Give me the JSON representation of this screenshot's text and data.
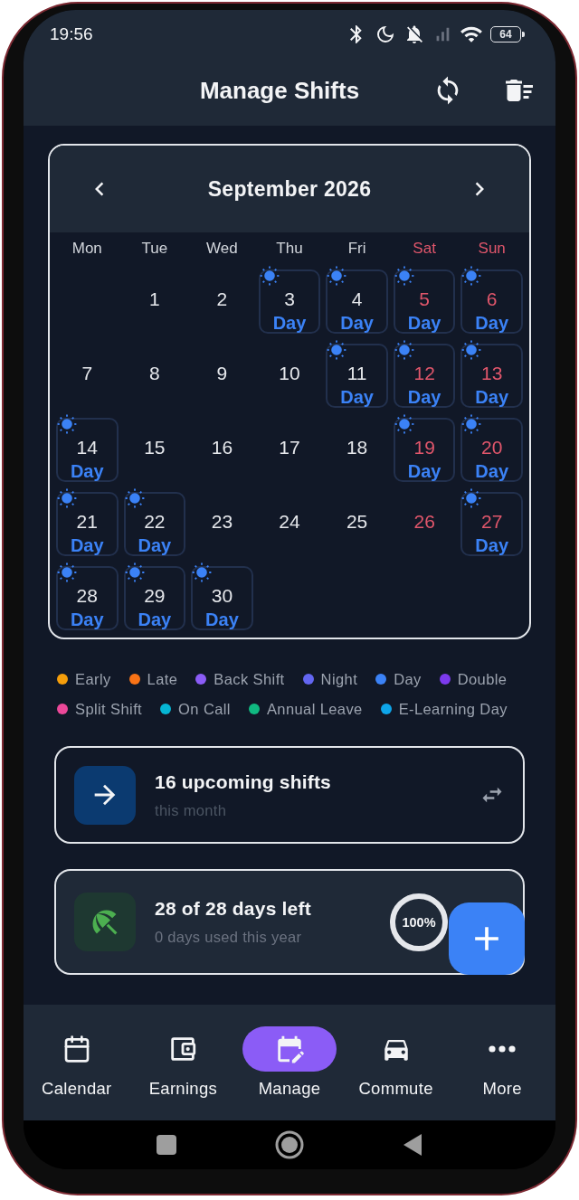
{
  "status_bar": {
    "time": "19:56",
    "battery": "64"
  },
  "header": {
    "title": "Manage Shifts"
  },
  "calendar": {
    "month": "September 2026",
    "weekdays": [
      {
        "label": "Mon",
        "weekend": false
      },
      {
        "label": "Tue",
        "weekend": false
      },
      {
        "label": "Wed",
        "weekend": false
      },
      {
        "label": "Thu",
        "weekend": false
      },
      {
        "label": "Fri",
        "weekend": false
      },
      {
        "label": "Sat",
        "weekend": true
      },
      {
        "label": "Sun",
        "weekend": true
      }
    ],
    "weeks": [
      [
        {
          "kind": "blank"
        },
        {
          "kind": "day",
          "number": "1",
          "weekend": false
        },
        {
          "kind": "day",
          "number": "2",
          "weekend": false
        },
        {
          "kind": "day",
          "number": "3",
          "weekend": false,
          "shift": {
            "label": "Day",
            "color": "#3b82f6"
          }
        },
        {
          "kind": "day",
          "number": "4",
          "weekend": false,
          "shift": {
            "label": "Day",
            "color": "#3b82f6"
          }
        },
        {
          "kind": "day",
          "number": "5",
          "weekend": true,
          "shift": {
            "label": "Day",
            "color": "#3b82f6"
          }
        },
        {
          "kind": "day",
          "number": "6",
          "weekend": true,
          "shift": {
            "label": "Day",
            "color": "#3b82f6"
          }
        }
      ],
      [
        {
          "kind": "day",
          "number": "7",
          "weekend": false
        },
        {
          "kind": "day",
          "number": "8",
          "weekend": false
        },
        {
          "kind": "day",
          "number": "9",
          "weekend": false
        },
        {
          "kind": "day",
          "number": "10",
          "weekend": false
        },
        {
          "kind": "day",
          "number": "11",
          "weekend": false,
          "shift": {
            "label": "Day",
            "color": "#3b82f6"
          }
        },
        {
          "kind": "day",
          "number": "12",
          "weekend": true,
          "shift": {
            "label": "Day",
            "color": "#3b82f6"
          }
        },
        {
          "kind": "day",
          "number": "13",
          "weekend": true,
          "shift": {
            "label": "Day",
            "color": "#3b82f6"
          }
        }
      ],
      [
        {
          "kind": "day",
          "number": "14",
          "weekend": false,
          "shift": {
            "label": "Day",
            "color": "#3b82f6"
          }
        },
        {
          "kind": "day",
          "number": "15",
          "weekend": false
        },
        {
          "kind": "day",
          "number": "16",
          "weekend": false
        },
        {
          "kind": "day",
          "number": "17",
          "weekend": false
        },
        {
          "kind": "day",
          "number": "18",
          "weekend": false
        },
        {
          "kind": "day",
          "number": "19",
          "weekend": true,
          "shift": {
            "label": "Day",
            "color": "#3b82f6"
          }
        },
        {
          "kind": "day",
          "number": "20",
          "weekend": true,
          "shift": {
            "label": "Day",
            "color": "#3b82f6"
          }
        }
      ],
      [
        {
          "kind": "day",
          "number": "21",
          "weekend": false,
          "shift": {
            "label": "Day",
            "color": "#3b82f6"
          }
        },
        {
          "kind": "day",
          "number": "22",
          "weekend": false,
          "shift": {
            "label": "Day",
            "color": "#3b82f6"
          }
        },
        {
          "kind": "day",
          "number": "23",
          "weekend": false
        },
        {
          "kind": "day",
          "number": "24",
          "weekend": false
        },
        {
          "kind": "day",
          "number": "25",
          "weekend": false
        },
        {
          "kind": "day",
          "number": "26",
          "weekend": true
        },
        {
          "kind": "day",
          "number": "27",
          "weekend": true,
          "shift": {
            "label": "Day",
            "color": "#3b82f6"
          }
        }
      ],
      [
        {
          "kind": "day",
          "number": "28",
          "weekend": false,
          "shift": {
            "label": "Day",
            "color": "#3b82f6"
          }
        },
        {
          "kind": "day",
          "number": "29",
          "weekend": false,
          "shift": {
            "label": "Day",
            "color": "#3b82f6"
          }
        },
        {
          "kind": "day",
          "number": "30",
          "weekend": false,
          "shift": {
            "label": "Day",
            "color": "#3b82f6"
          }
        }
      ]
    ]
  },
  "legend": [
    {
      "label": "Early",
      "color": "#f59e0b"
    },
    {
      "label": "Late",
      "color": "#f97316"
    },
    {
      "label": "Back Shift",
      "color": "#8b5cf6"
    },
    {
      "label": "Night",
      "color": "#6366f1"
    },
    {
      "label": "Day",
      "color": "#3b82f6"
    },
    {
      "label": "Double",
      "color": "#7c3aed"
    },
    {
      "label": "Split Shift",
      "color": "#ec4899"
    },
    {
      "label": "On Call",
      "color": "#06b6d4"
    },
    {
      "label": "Annual Leave",
      "color": "#10b981"
    },
    {
      "label": "E-Learning Day",
      "color": "#0ea5e9"
    }
  ],
  "summary_cards": [
    {
      "kind": "upcoming",
      "title": "16 upcoming shifts",
      "subtitle": "this month"
    },
    {
      "kind": "leave",
      "title": "28 of 28 days left",
      "subtitle": "0 days used this year",
      "progress": {
        "level": 1,
        "reading": "100%"
      }
    }
  ],
  "nav": [
    {
      "label": "Calendar",
      "selected": false
    },
    {
      "label": "Earnings",
      "selected": false
    },
    {
      "label": "Manage",
      "selected": true
    },
    {
      "label": "Commute",
      "selected": false
    },
    {
      "label": "More",
      "selected": false
    }
  ]
}
